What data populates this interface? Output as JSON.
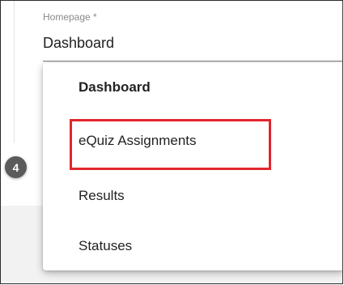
{
  "homepage_field": {
    "label": "Homepage *",
    "value": "Dashboard"
  },
  "step": {
    "number": "4"
  },
  "dropdown": {
    "items": [
      {
        "label": "Dashboard",
        "selected": true
      },
      {
        "label": "eQuiz Assignments",
        "highlighted": true
      },
      {
        "label": "Results"
      },
      {
        "label": "Statuses"
      }
    ]
  },
  "colors": {
    "highlight": "#e0262c",
    "badge": "#5b5b5b"
  }
}
